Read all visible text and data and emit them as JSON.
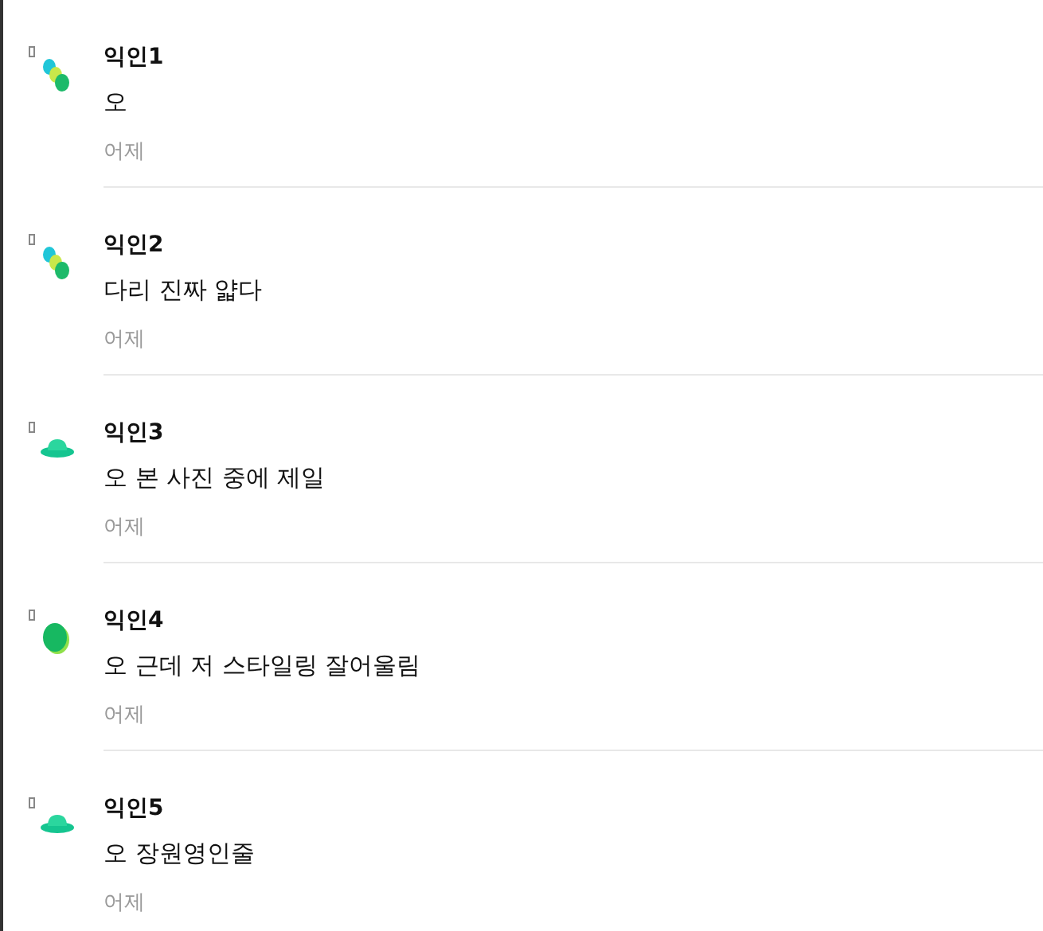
{
  "comments": [
    {
      "author": "익인1",
      "text": "오",
      "time": "어제",
      "avatar": {
        "kind": "beads"
      }
    },
    {
      "author": "익인2",
      "text": "다리 진짜 얇다",
      "time": "어제",
      "avatar": {
        "kind": "beads"
      }
    },
    {
      "author": "익인3",
      "text": "오 본 사진 중에 제일",
      "time": "어제",
      "avatar": {
        "kind": "hat"
      }
    },
    {
      "author": "익인4",
      "text": "오 근데 저 스타일링 잘어울림",
      "time": "어제",
      "avatar": {
        "kind": "egg"
      }
    },
    {
      "author": "익인5",
      "text": "오 장원영인줄",
      "time": "어제",
      "avatar": {
        "kind": "hat"
      }
    }
  ]
}
